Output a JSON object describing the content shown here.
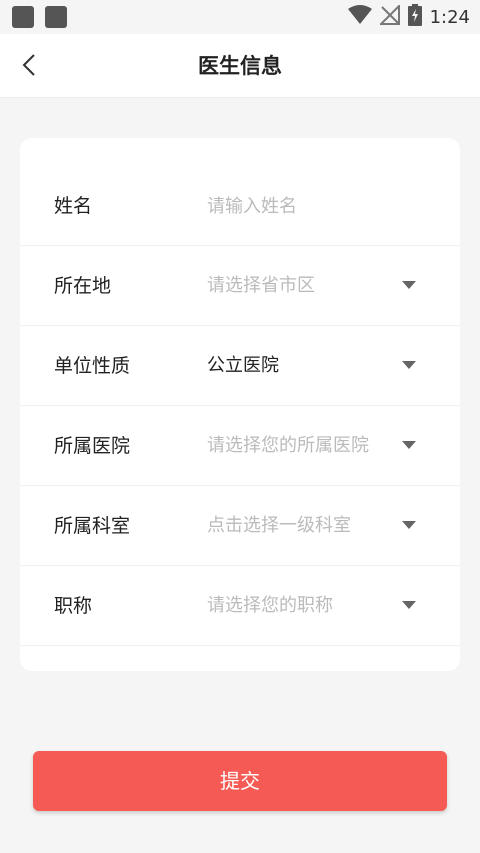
{
  "status_bar": {
    "time": "1:24",
    "icons": [
      "notification-square-icon",
      "notification-square-icon",
      "wifi-icon",
      "no-signal-icon",
      "battery-charging-icon"
    ]
  },
  "header": {
    "back_icon": "chevron-left-icon",
    "title": "医生信息"
  },
  "form": {
    "name": {
      "label": "姓名",
      "placeholder": "请输入姓名",
      "value": ""
    },
    "location": {
      "label": "所在地",
      "placeholder": "请选择省市区"
    },
    "unit_type": {
      "label": "单位性质",
      "value": "公立医院"
    },
    "hospital": {
      "label": "所属医院",
      "placeholder": "请选择您的所属医院"
    },
    "department": {
      "label": "所属科室",
      "placeholder": "点击选择一级科室"
    },
    "title": {
      "label": "职称",
      "placeholder": "请选择您的职称"
    }
  },
  "submit": {
    "label": "提交"
  },
  "colors": {
    "accent": "#f55a55",
    "background": "#f5f5f5",
    "placeholder": "#bbbbbb",
    "text": "#222222"
  }
}
